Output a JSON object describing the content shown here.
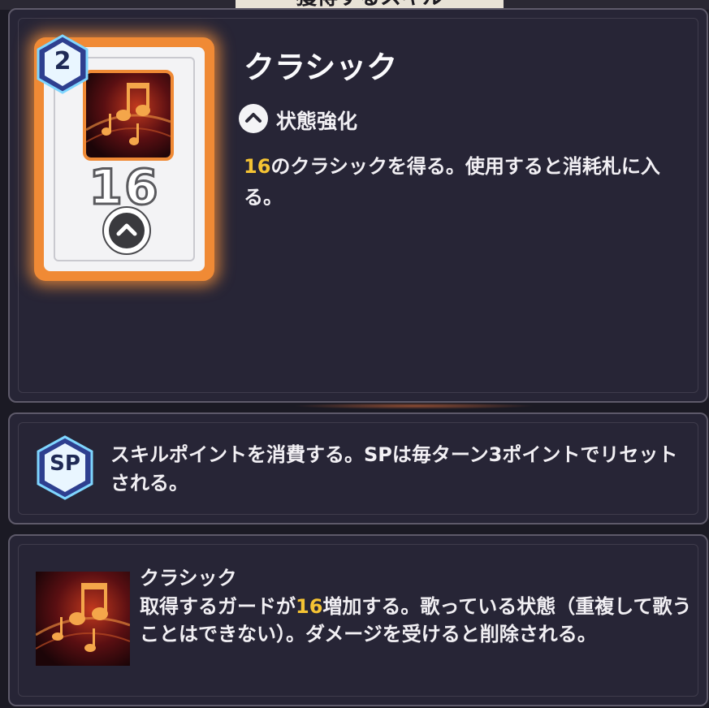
{
  "header": {
    "title_partial": "獲得するスキル"
  },
  "card": {
    "level": "2",
    "cost": "16",
    "type_icon": "chevron-up-icon",
    "art_icon": "music-notes-icon",
    "frame_color": "#f08a35"
  },
  "skill": {
    "name": "クラシック",
    "type_label": "状態強化",
    "type_icon": "chevron-up-icon",
    "desc_highlight": "16",
    "desc_rest": "のクラシックを得る。使用すると消耗札に入る。",
    "highlight_color": "#f5c333"
  },
  "sp_info": {
    "badge": "SP",
    "text": "スキルポイントを消費する。SPは毎ターン3ポイントでリセットされる。"
  },
  "status": {
    "name": "クラシック",
    "desc_before": "取得するガードが",
    "desc_highlight": "16",
    "desc_after": "増加する。歌っている状態（重複して歌うことはできない）。ダメージを受けると削除される。",
    "art_icon": "music-notes-icon"
  }
}
